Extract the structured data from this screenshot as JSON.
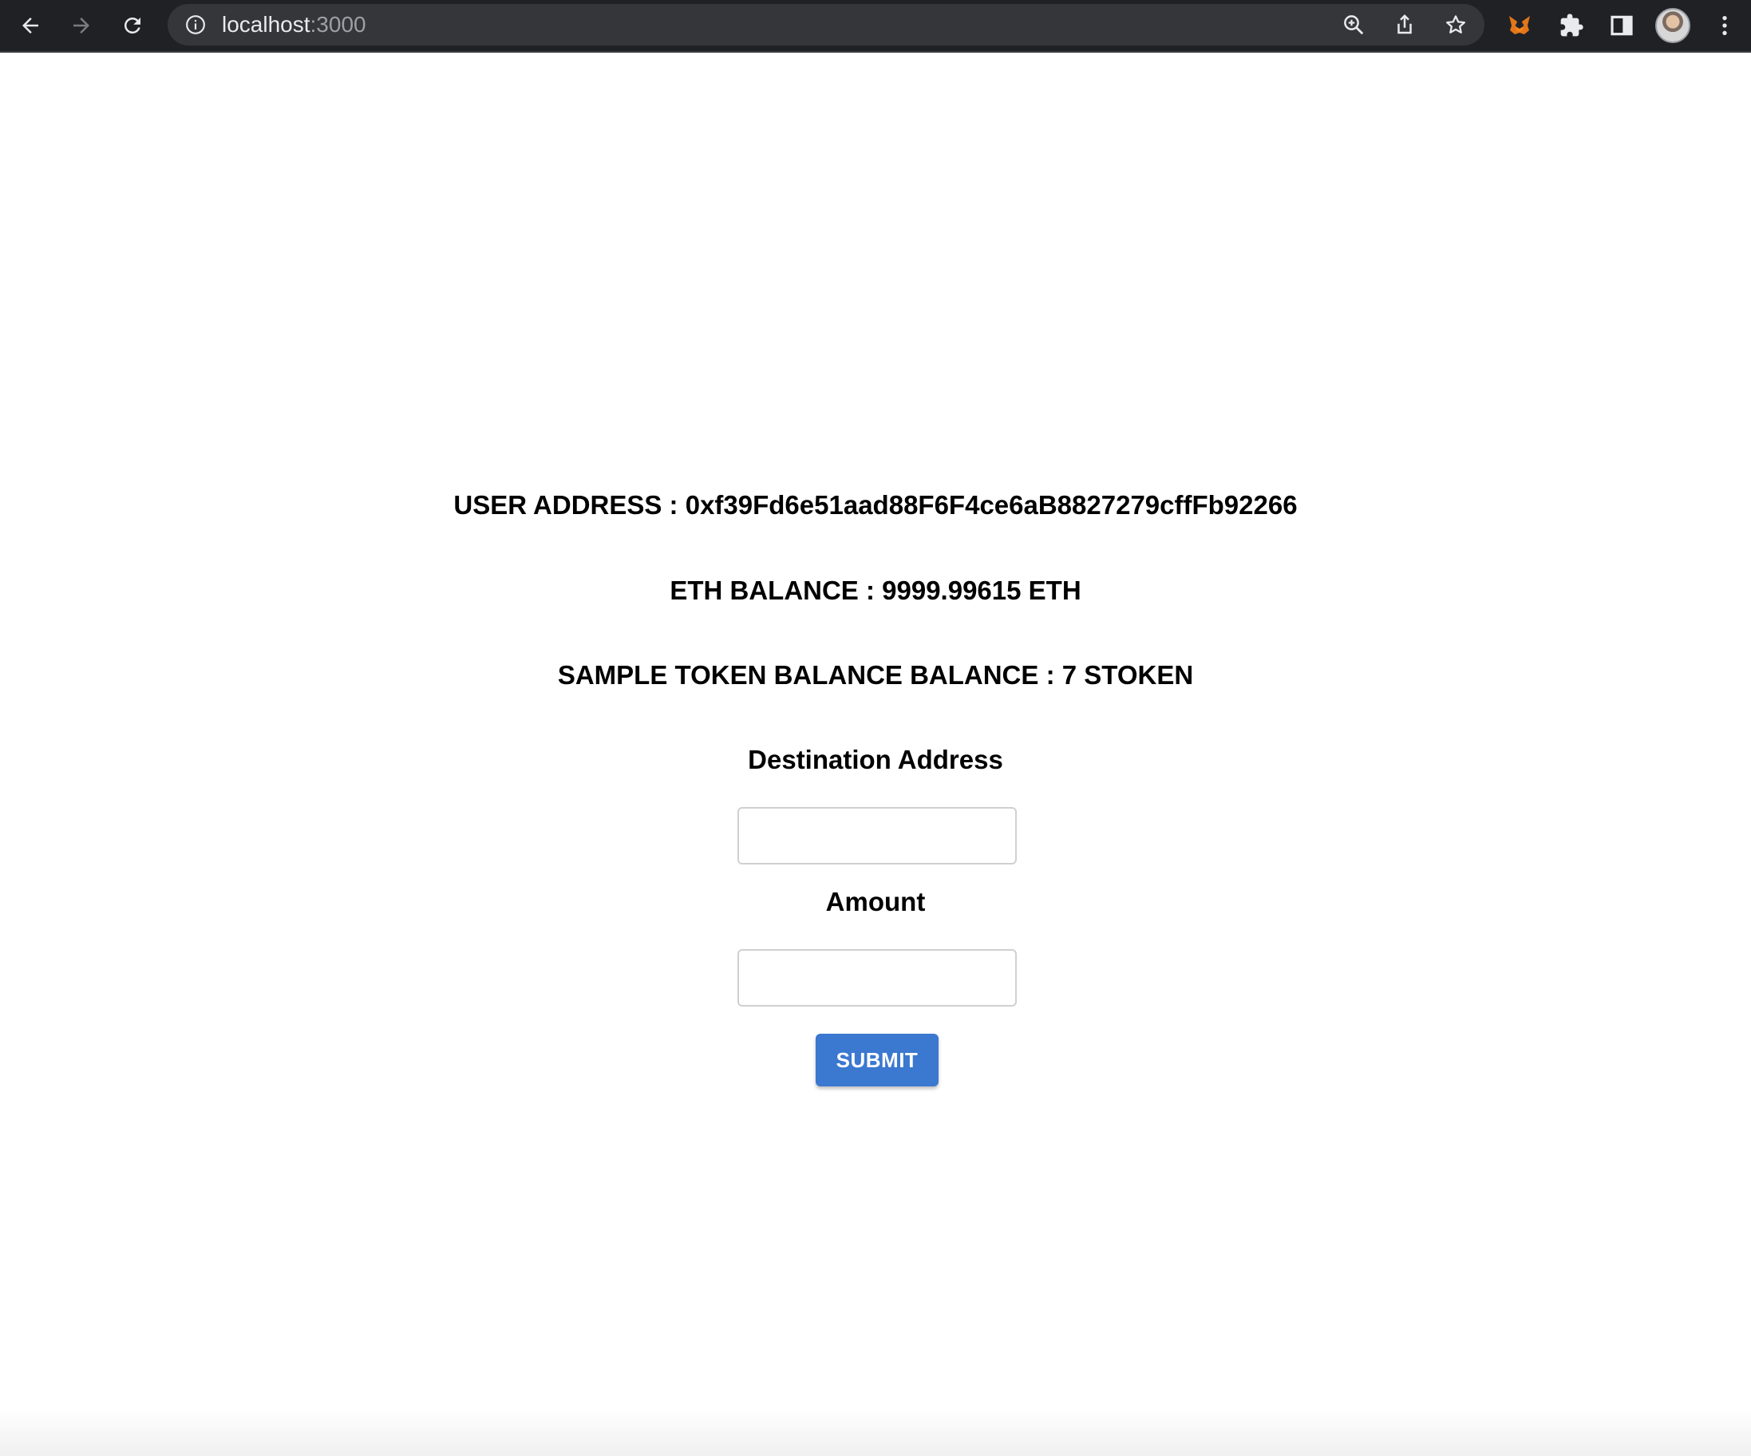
{
  "browser": {
    "url_host": "localhost",
    "url_port": ":3000",
    "icons": {
      "back": "back-arrow-icon",
      "forward": "forward-arrow-icon",
      "reload": "reload-icon",
      "site_info": "info-icon",
      "zoom": "zoom-icon",
      "share": "share-icon",
      "bookmark": "star-icon",
      "metamask": "metamask-fox-icon",
      "extensions": "puzzle-icon",
      "side_panel": "side-panel-icon",
      "profile": "avatar",
      "menu": "kebab-menu-icon"
    },
    "colors": {
      "toolbar_bg": "#202124",
      "omnibox_bg": "#35363a"
    }
  },
  "page": {
    "user_address_line": "USER ADDRESS : 0xf39Fd6e51aad88F6F4ce6aB8827279cffFb92266",
    "eth_balance_line": "ETH BALANCE : 9999.99615 ETH",
    "token_balance_line": "SAMPLE TOKEN BALANCE BALANCE : 7 STOKEN",
    "destination_label": "Destination Address",
    "destination_value": "",
    "amount_label": "Amount",
    "amount_value": "",
    "submit_label": "SUBMIT",
    "colors": {
      "submit_bg": "#3b78d0",
      "text": "#000000"
    }
  }
}
